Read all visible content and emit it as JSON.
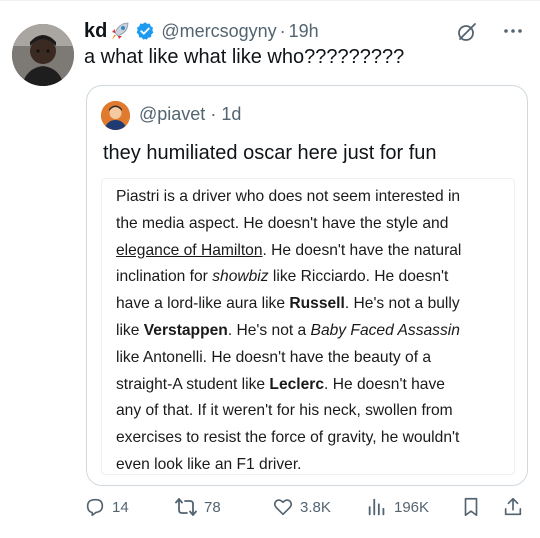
{
  "tweet": {
    "display_name": "kd",
    "handle": "@mercsogyny",
    "separator": "·",
    "time": "19h",
    "text": "a what like what like who?????????"
  },
  "quote": {
    "handle": "@piavet",
    "separator": "·",
    "time": "1d",
    "text": "they humiliated oscar here just for fun",
    "image_text": [
      [
        {
          "t": "Piastri is a driver who does not seem interested in"
        }
      ],
      [
        {
          "t": "the media aspect. He doesn't have the style and"
        }
      ],
      [
        {
          "t": "elegance of Hamilton",
          "s": "u"
        },
        {
          "t": ". He doesn't have the natural"
        }
      ],
      [
        {
          "t": "inclination for "
        },
        {
          "t": "showbiz",
          "s": "i"
        },
        {
          "t": " like Ricciardo. He doesn't"
        }
      ],
      [
        {
          "t": "have a lord-like aura like "
        },
        {
          "t": "Russell",
          "s": "b"
        },
        {
          "t": ". He's not a bully"
        }
      ],
      [
        {
          "t": "like "
        },
        {
          "t": "Verstappen",
          "s": "b"
        },
        {
          "t": ". He's not a "
        },
        {
          "t": "Baby Faced Assassin",
          "s": "i"
        }
      ],
      [
        {
          "t": "like Antonelli. He doesn't have the beauty of a"
        }
      ],
      [
        {
          "t": "straight-A student like "
        },
        {
          "t": "Leclerc",
          "s": "b"
        },
        {
          "t": ". He doesn't have"
        }
      ],
      [
        {
          "t": "any of that. If it weren't for his neck, swollen from"
        }
      ],
      [
        {
          "t": "exercises to resist the force of gravity, he wouldn't"
        }
      ],
      [
        {
          "t": "even look like an F1 driver."
        }
      ]
    ]
  },
  "actions": {
    "replies": "14",
    "reposts": "78",
    "likes": "3.8K",
    "views": "196K"
  },
  "icons": {
    "verified": "verified-badge-icon",
    "rocket": "rocket-emoji-icon",
    "grok": "grok-icon",
    "more": "more-icon",
    "reply": "reply-icon",
    "repost": "repost-icon",
    "like": "heart-icon",
    "views": "views-icon",
    "bookmark": "bookmark-icon",
    "share": "share-icon"
  },
  "colors": {
    "verified": "#1d9bf0",
    "text": "#0f1419",
    "secondary": "#536471",
    "border": "#cfd9de"
  }
}
